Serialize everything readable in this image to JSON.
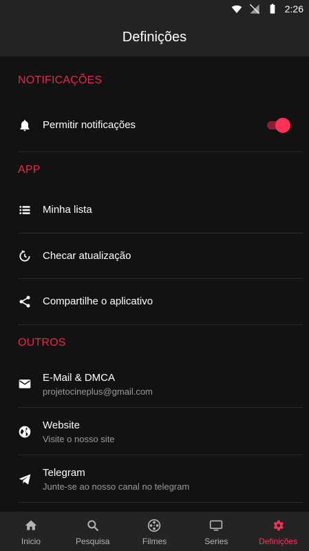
{
  "status_bar": {
    "time": "2:26"
  },
  "app_bar": {
    "title": "Definições"
  },
  "sections": {
    "notifications": {
      "header": "NOTIFICAÇÕES",
      "items": [
        {
          "label": "Permitir notificações",
          "icon": "bell-icon",
          "toggle_on": true
        }
      ]
    },
    "app": {
      "header": "APP",
      "items": [
        {
          "label": "Minha lista",
          "icon": "list-icon"
        },
        {
          "label": "Checar atualização",
          "icon": "update-icon"
        },
        {
          "label": "Compartilhe o aplicativo",
          "icon": "share-icon"
        }
      ]
    },
    "others": {
      "header": "OUTROS",
      "items": [
        {
          "label": "E-Mail & DMCA",
          "sub": "projetocineplus@gmail.com",
          "icon": "mail-icon"
        },
        {
          "label": "Website",
          "sub": "Visite o nosso site",
          "icon": "globe-icon"
        },
        {
          "label": "Telegram",
          "sub": "Junte-se ao nosso canal no telegram",
          "icon": "telegram-icon"
        }
      ]
    }
  },
  "bottom_nav": [
    {
      "label": "Inicio",
      "icon": "home-icon"
    },
    {
      "label": "Pesquisa",
      "icon": "search-icon"
    },
    {
      "label": "Filmes",
      "icon": "film-reel-icon"
    },
    {
      "label": "Series",
      "icon": "tv-icon"
    },
    {
      "label": "Definições",
      "icon": "gear-icon",
      "active": true
    }
  ],
  "colors": {
    "accent": "#ff3158",
    "section_header": "#e8294d",
    "background": "#121212",
    "bar": "#232323"
  }
}
